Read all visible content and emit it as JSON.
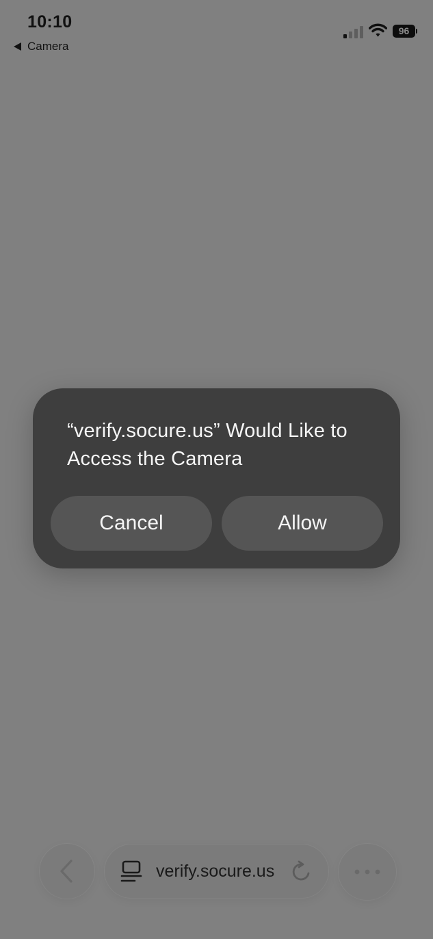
{
  "status_bar": {
    "time": "10:10",
    "back_label": "Camera",
    "battery_level": "96",
    "signal_icon": "cellular-signal-icon",
    "wifi_icon": "wifi-icon"
  },
  "dialog": {
    "title": "“verify.socure.us” Would Like to Access the Camera",
    "cancel_label": "Cancel",
    "allow_label": "Allow"
  },
  "toolbar": {
    "url": "verify.socure.us",
    "back_icon": "chevron-left-icon",
    "reader_icon": "page-menu-icon",
    "reload_icon": "reload-icon",
    "more_icon": "more-icon"
  },
  "colors": {
    "dimmed_background": "#808080",
    "dialog_background": "#3e3e3e",
    "dialog_button": "#555555",
    "dialog_text": "#f6f6f6"
  }
}
